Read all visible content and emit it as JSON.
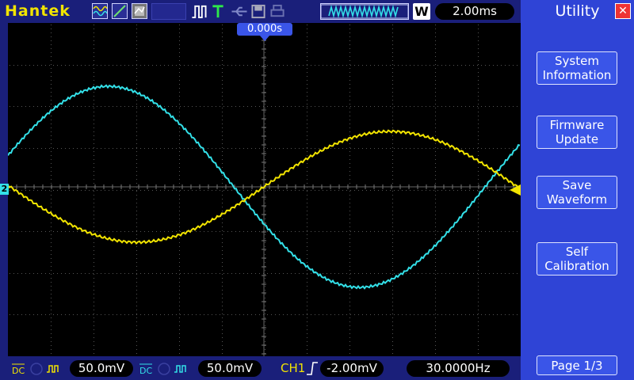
{
  "brand": "Hantek",
  "timebase": "2.00ms",
  "trigger_position": "0.000s",
  "top_badge": "W",
  "utility": {
    "title": "Utility",
    "buttons": [
      {
        "label": "System\nInformation"
      },
      {
        "label": "Firmware\nUpdate"
      },
      {
        "label": "Save\nWaveform"
      },
      {
        "label": "Self\nCalibration"
      }
    ],
    "page": "Page 1/3"
  },
  "channel_marker": "2",
  "bottom": {
    "ch1_scale": "50.0mV",
    "ch2_scale": "50.0mV",
    "trigger_source": "CH1",
    "trigger_level": "-2.00mV",
    "frequency": "30.0000Hz"
  },
  "colors": {
    "ch1": "#f2e400",
    "ch2": "#33e0e8",
    "panel": "#2f44d6",
    "frame": "#1a1f7a"
  },
  "icons": [
    "wave-icon",
    "line-icon",
    "persist-icon",
    "pulse-icon",
    "trigger-t-icon",
    "usb-icon",
    "save-icon",
    "printer-icon",
    "close-icon"
  ]
}
